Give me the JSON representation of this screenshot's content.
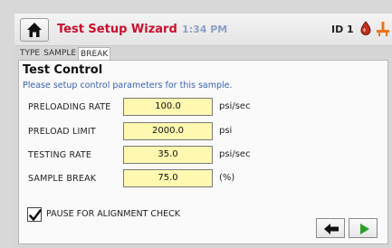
{
  "header": {
    "home_icon": "home-icon",
    "title": "Test Setup Wizard",
    "clock": "1:34 PM",
    "id_label": "ID 1",
    "status_icons": [
      "drop-icon",
      "warning-icon"
    ],
    "colors": {
      "title": "#c8102e",
      "clock": "#8fa0c8"
    }
  },
  "tabs": [
    {
      "label": "TYPE",
      "active": false
    },
    {
      "label": "SAMPLE",
      "active": false
    },
    {
      "label": "BREAK",
      "active": true
    }
  ],
  "panel": {
    "heading": "Test Control",
    "subtitle": "Please setup control parameters for this sample.",
    "rows": [
      {
        "label": "PRELOADING RATE",
        "value": "100.0",
        "unit": "psi/sec"
      },
      {
        "label": "PRELOAD LIMIT",
        "value": "2000.0",
        "unit": "psi"
      },
      {
        "label": "TESTING RATE",
        "value": "35.0",
        "unit": "psi/sec"
      },
      {
        "label": "SAMPLE BREAK",
        "value": "75.0",
        "unit": "(%)"
      }
    ],
    "field_color": "#fff8b0",
    "pause_checkbox": {
      "label": "PAUSE FOR ALIGNMENT CHECK",
      "checked": true
    }
  },
  "nav": {
    "back_icon": "arrow-left-icon",
    "next_icon": "play-right-icon",
    "next_color": "#2aa02a"
  }
}
